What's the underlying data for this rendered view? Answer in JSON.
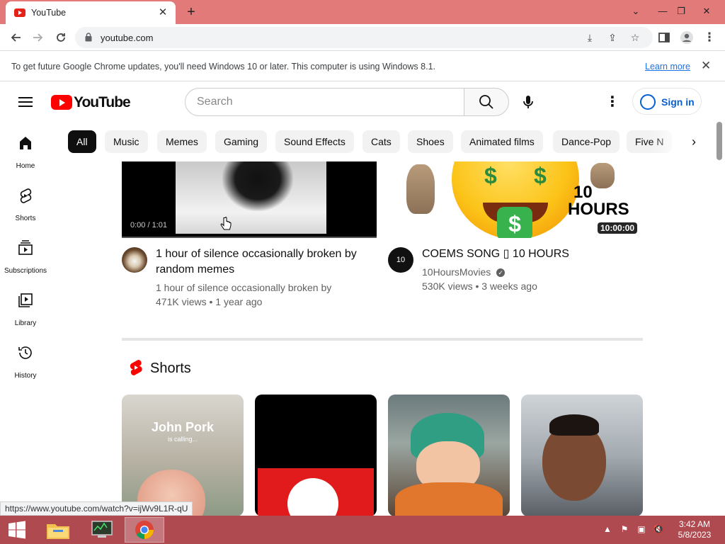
{
  "browser": {
    "tab_title": "YouTube",
    "url": "youtube.com",
    "infobar_message": "To get future Google Chrome updates, you'll need Windows 10 or later. This computer is using Windows 8.1.",
    "infobar_link": "Learn more",
    "status_url": "https://www.youtube.com/watch?v=ijWv9L1R-qU"
  },
  "youtube": {
    "logo_text": "YouTube",
    "search_placeholder": "Search",
    "sign_in": "Sign in",
    "sidebar": [
      {
        "label": "Home",
        "icon": "home-icon"
      },
      {
        "label": "Shorts",
        "icon": "shorts-icon"
      },
      {
        "label": "Subscriptions",
        "icon": "subscriptions-icon"
      },
      {
        "label": "Library",
        "icon": "library-icon"
      },
      {
        "label": "History",
        "icon": "history-icon"
      }
    ],
    "chips": [
      "All",
      "Music",
      "Memes",
      "Gaming",
      "Sound Effects",
      "Cats",
      "Shoes",
      "Animated films",
      "Dance-Pop",
      "Five N"
    ],
    "videos": [
      {
        "title": "1 hour of silence occasionally broken by random memes",
        "channel": "1 hour of silence occasionally broken by",
        "meta": "471K views • 1 year ago",
        "progress_text": "0:00 / 1:01"
      },
      {
        "title": "COEMS SONG ▯ 10 HOURS",
        "channel": "10HoursMovies",
        "meta": "530K views • 3 weeks ago",
        "duration": "10:00:00",
        "thumb_text_big": "10",
        "thumb_text_small": "HOURS",
        "avatar_text": "10"
      }
    ],
    "shorts_title": "Shorts",
    "shorts": [
      {
        "overlay_text": "John Pork",
        "overlay_sub": "is calling..."
      },
      {
        "overlay_text": ""
      },
      {
        "overlay_text": ""
      },
      {
        "overlay_text": ""
      }
    ]
  },
  "taskbar": {
    "time": "3:42 AM",
    "date": "5/8/2023"
  },
  "colors": {
    "tabstrip": "#e27a7a",
    "taskbar": "#b04a51",
    "yt_red": "#ff0000",
    "link_blue": "#065fd4"
  }
}
